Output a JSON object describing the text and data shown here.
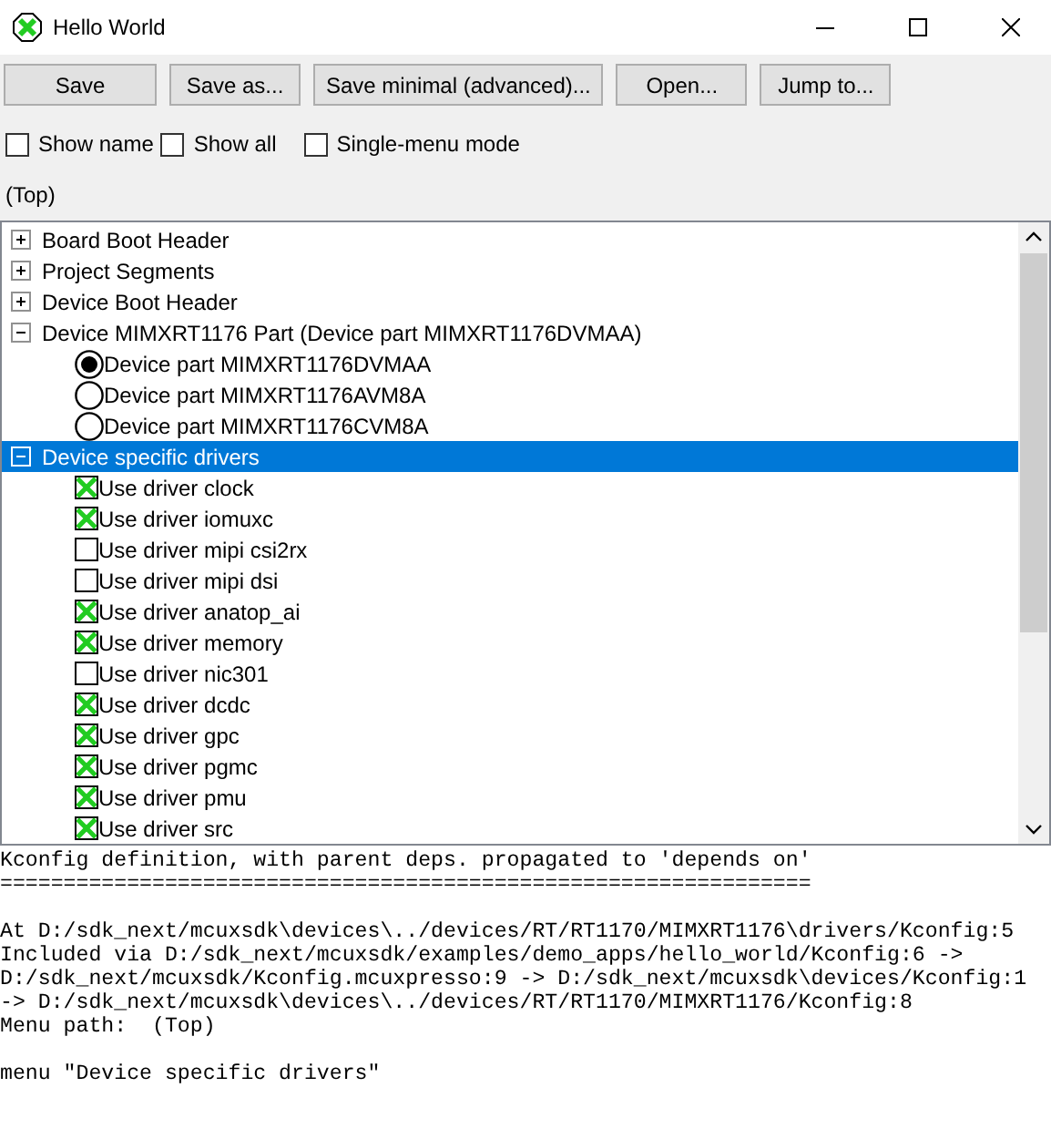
{
  "window": {
    "title": "Hello World"
  },
  "toolbar": [
    "Save",
    "Save as...",
    "Save minimal (advanced)...",
    "Open...",
    "Jump to..."
  ],
  "options": [
    {
      "label": "Show name",
      "checked": false
    },
    {
      "label": "Show all",
      "checked": false
    },
    {
      "label": "Single-menu mode",
      "checked": false
    }
  ],
  "path": "(Top)",
  "tree": [
    {
      "label": "Board Boot Header",
      "kind": "menu",
      "expanded": false,
      "selected": false
    },
    {
      "label": "Project Segments",
      "kind": "menu",
      "expanded": false,
      "selected": false
    },
    {
      "label": "Device Boot Header",
      "kind": "menu",
      "expanded": false,
      "selected": false
    },
    {
      "label": "Device MIMXRT1176 Part (Device part MIMXRT1176DVMAA)",
      "kind": "menu",
      "expanded": true,
      "selected": false,
      "children": [
        {
          "label": "Device part MIMXRT1176DVMAA",
          "kind": "radio",
          "checked": true,
          "selected": false
        },
        {
          "label": "Device part MIMXRT1176AVM8A",
          "kind": "radio",
          "checked": false,
          "selected": false
        },
        {
          "label": "Device part MIMXRT1176CVM8A",
          "kind": "radio",
          "checked": false,
          "selected": false
        }
      ]
    },
    {
      "label": "Device specific drivers",
      "kind": "menu",
      "expanded": true,
      "selected": true,
      "children": [
        {
          "label": "Use driver clock",
          "kind": "checkbox",
          "checked": true,
          "selected": false
        },
        {
          "label": "Use driver iomuxc",
          "kind": "checkbox",
          "checked": true,
          "selected": false
        },
        {
          "label": "Use driver mipi csi2rx",
          "kind": "checkbox",
          "checked": false,
          "selected": false
        },
        {
          "label": "Use driver mipi dsi",
          "kind": "checkbox",
          "checked": false,
          "selected": false
        },
        {
          "label": "Use driver anatop_ai",
          "kind": "checkbox",
          "checked": true,
          "selected": false
        },
        {
          "label": "Use driver memory",
          "kind": "checkbox",
          "checked": true,
          "selected": false
        },
        {
          "label": "Use driver nic301",
          "kind": "checkbox",
          "checked": false,
          "selected": false
        },
        {
          "label": "Use driver dcdc",
          "kind": "checkbox",
          "checked": true,
          "selected": false
        },
        {
          "label": "Use driver gpc",
          "kind": "checkbox",
          "checked": true,
          "selected": false
        },
        {
          "label": "Use driver pgmc",
          "kind": "checkbox",
          "checked": true,
          "selected": false
        },
        {
          "label": "Use driver pmu",
          "kind": "checkbox",
          "checked": true,
          "selected": false
        },
        {
          "label": "Use driver src",
          "kind": "checkbox",
          "checked": true,
          "selected": false
        }
      ]
    }
  ],
  "info": {
    "heading": "Kconfig definition, with parent deps. propagated to 'depends on'",
    "rule": "================================================================",
    "location": [
      "At D:/sdk_next/mcuxsdk\\devices\\../devices/RT/RT1170/MIMXRT1176\\drivers/Kconfig:5",
      "Included via D:/sdk_next/mcuxsdk/examples/demo_apps/hello_world/Kconfig:6 ->",
      "D:/sdk_next/mcuxsdk/Kconfig.mcuxpresso:9 -> D:/sdk_next/mcuxsdk\\devices/Kconfig:1",
      "-> D:/sdk_next/mcuxsdk\\devices\\../devices/RT/RT1170/MIMXRT1176/Kconfig:8",
      "Menu path:  (Top)"
    ],
    "definition": "menu \"Device specific drivers\""
  }
}
